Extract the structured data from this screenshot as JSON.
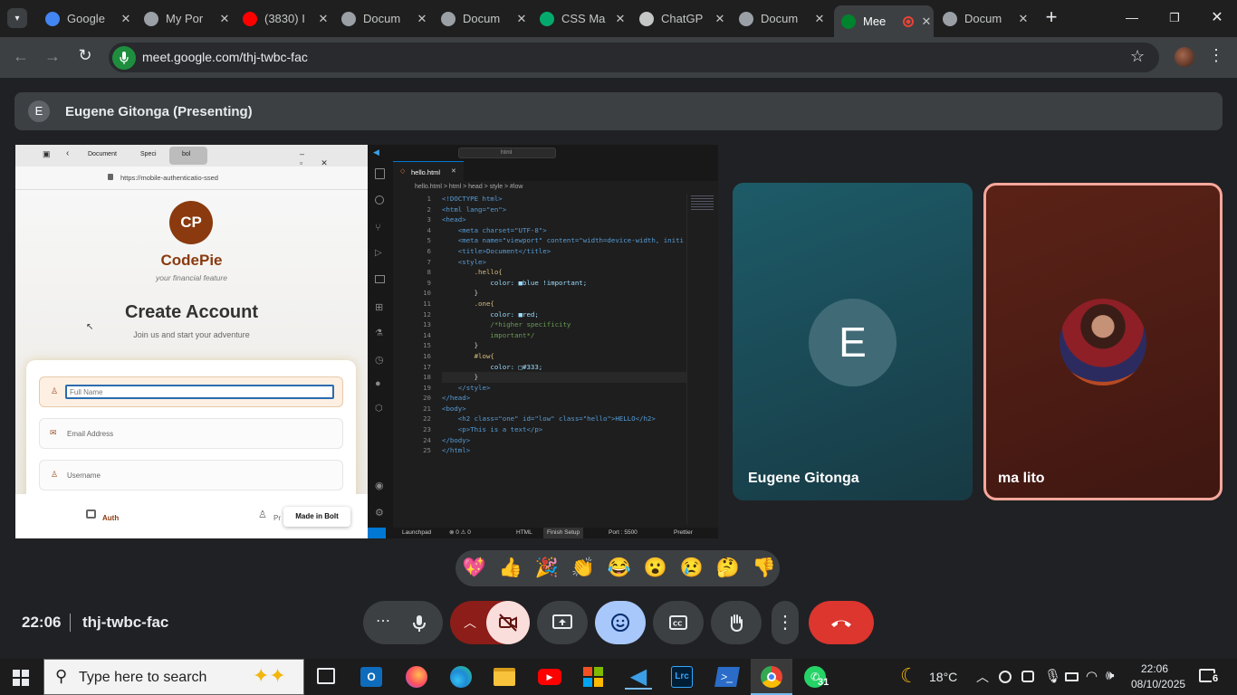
{
  "browser": {
    "tabs": [
      {
        "title": "Google",
        "icon": "google-icon",
        "color": "#4285f4"
      },
      {
        "title": "My Por",
        "icon": "globe-icon",
        "color": "#9aa0a6"
      },
      {
        "title": "(3830) I",
        "icon": "youtube-icon",
        "color": "#ff0000"
      },
      {
        "title": "Docum",
        "icon": "globe-icon",
        "color": "#9aa0a6"
      },
      {
        "title": "Docum",
        "icon": "globe-icon",
        "color": "#9aa0a6"
      },
      {
        "title": "CSS Ma",
        "icon": "w3schools-icon",
        "color": "#04aa6d"
      },
      {
        "title": "ChatGP",
        "icon": "chatgpt-icon",
        "color": "#c4c7c5"
      },
      {
        "title": "Docum",
        "icon": "globe-icon",
        "color": "#9aa0a6"
      },
      {
        "title": "Mee",
        "icon": "google-meet-icon",
        "color": "#00832d"
      },
      {
        "title": "Docum",
        "icon": "globe-icon",
        "color": "#9aa0a6"
      }
    ],
    "url": "meet.google.com/thj-twbc-fac"
  },
  "meet": {
    "presenter_initial": "E",
    "presenter_label": "Eugene Gitonga (Presenting)",
    "participants": [
      {
        "name": "Eugene Gitonga",
        "initial": "E"
      },
      {
        "name": "ma lito"
      }
    ],
    "time": "22:06",
    "meeting_code": "thj-twbc-fac",
    "reactions": [
      "💖",
      "👍",
      "🎉",
      "👏",
      "😂",
      "😮",
      "😢",
      "🤔",
      "👎"
    ]
  },
  "shared": {
    "inner_tabs": [
      "Document",
      "Speci",
      "bol"
    ],
    "inner_url": "https://mobile-authenticatio-ssed",
    "logo": "CP",
    "brand": "CodePie",
    "tagline": "your financial feature",
    "heading": "Create Account",
    "subheading": "Join us and start your adventure",
    "fields": [
      "Full Name",
      "Email Address",
      "Username"
    ],
    "bottom_auth": "Auth",
    "bottom_pr": "Pr",
    "made_in": "Made in Bolt",
    "vscode_search": "html",
    "file_tab": "hello.html",
    "breadcrumb": "hello.html > html > head > style > #low",
    "code_lines": [
      "<!DOCTYPE html>",
      "<html lang=\"en\">",
      "<head>",
      "    <meta charset=\"UTF-8\">",
      "    <meta name=\"viewport\" content=\"width=device-width, initi",
      "    <title>Document</title>",
      "    <style>",
      "        .hello{",
      "            color: ■blue !important;",
      "        }",
      "        .one{",
      "            color: ■red;",
      "            /*higher specificity",
      "            important*/",
      "        }",
      "        #low{",
      "            color: □#333;",
      "        }",
      "    </style>",
      "</head>",
      "<body>",
      "    <h2 class=\"one\" id=\"low\" class=\"hello\">HELLO</h2>",
      "    <p>This is a text</p>",
      "</body>",
      "</html>"
    ],
    "status_left": "Launchpad",
    "status_errors": "⊗ 0 ⚠ 0",
    "status_lang": "HTML",
    "status_setup": "Finish Setup",
    "status_port": "Port : 5500",
    "status_prettier": "Prettier"
  },
  "taskbar": {
    "search_placeholder": "Type here to search",
    "whatsapp_badge": "31",
    "temperature": "18°C",
    "clock_time": "22:06",
    "clock_date": "08/10/2025",
    "notif_count": "6"
  },
  "colors": {
    "meet_bg": "#202124",
    "end_call": "#ea4335",
    "reaction_active": "#a8c7fa",
    "camera_off": "#f9dedc",
    "tile_teal": "#1d4a55",
    "tile_brown": "#5a1f16"
  }
}
